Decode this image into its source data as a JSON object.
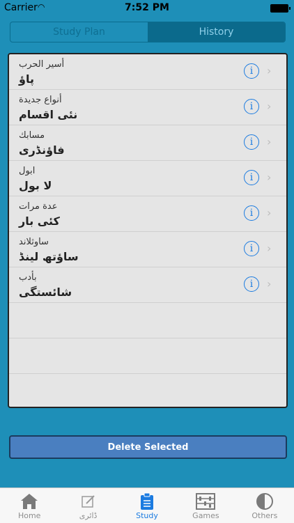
{
  "status_bar": {
    "carrier": "Carrier",
    "time": "7:52 PM"
  },
  "segments": [
    {
      "label": "Study Plan",
      "active": false
    },
    {
      "label": "History",
      "active": true
    }
  ],
  "rows": [
    {
      "arabic": "أسير الحرب",
      "urdu": "پاؤ"
    },
    {
      "arabic": "أنواع جديدة",
      "urdu": "نئی اقسام"
    },
    {
      "arabic": "مسابك",
      "urdu": "فاؤنڈری"
    },
    {
      "arabic": "ابول",
      "urdu": "لا بول"
    },
    {
      "arabic": "عدة مرات",
      "urdu": "کئی بار"
    },
    {
      "arabic": "ساوثلاند",
      "urdu": "ساؤتھ لینڈ"
    },
    {
      "arabic": "بأدب",
      "urdu": "شائستگی"
    }
  ],
  "delete_label": "Delete Selected",
  "tabbar": [
    {
      "label": "Home",
      "icon": "home-icon"
    },
    {
      "label": "ڈائری",
      "icon": "edit-icon"
    },
    {
      "label": "Study",
      "icon": "clipboard-icon"
    },
    {
      "label": "Games",
      "icon": "abacus-icon"
    },
    {
      "label": "Others",
      "icon": "half-circle-icon"
    }
  ],
  "colors": {
    "background": "#1e8fb8",
    "accent": "#1b7be0",
    "delete_button": "#4a7fc0"
  }
}
